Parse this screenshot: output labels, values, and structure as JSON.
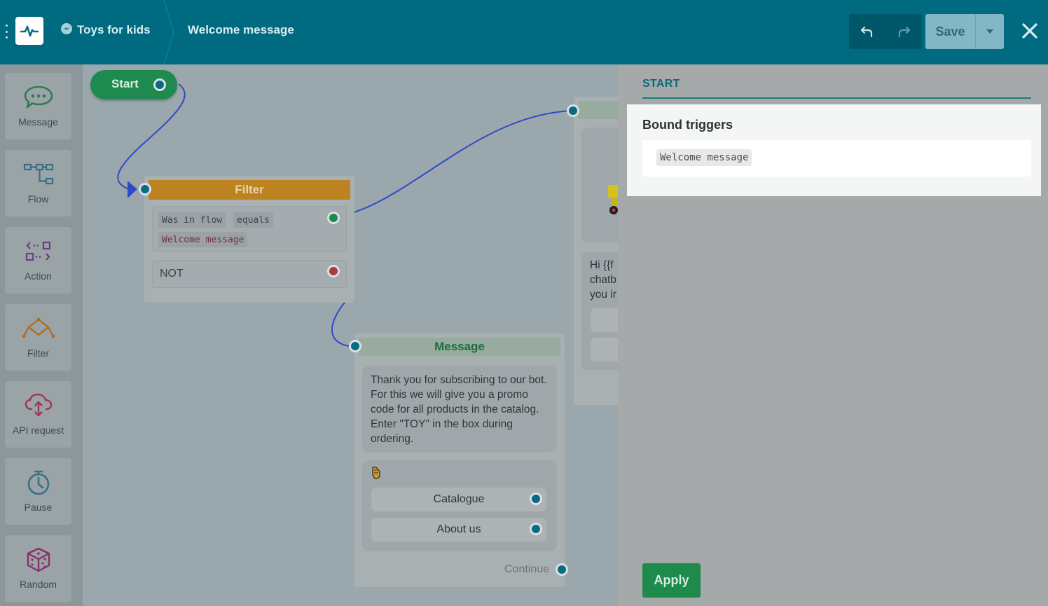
{
  "header": {
    "bot_name": "Toys for kids",
    "flow_name": "Welcome message",
    "save_label": "Save"
  },
  "toolbox": [
    {
      "label": "Message",
      "icon": "message-icon"
    },
    {
      "label": "Flow",
      "icon": "flow-icon"
    },
    {
      "label": "Action",
      "icon": "action-icon"
    },
    {
      "label": "Filter",
      "icon": "filter-icon"
    },
    {
      "label": "API request",
      "icon": "api-request-icon"
    },
    {
      "label": "Pause",
      "icon": "pause-icon"
    },
    {
      "label": "Random",
      "icon": "random-icon"
    }
  ],
  "canvas": {
    "start_label": "Start",
    "filter": {
      "title": "Filter",
      "condition": [
        "Was in flow",
        "equals",
        "Welcome message"
      ],
      "not_label": "NOT"
    },
    "message": {
      "title": "Message",
      "text": "Thank you for subscribing to our bot. For this we will give you a promo code for all products in the catalog. Enter \"TOY\" in the box during ordering.",
      "buttons": [
        "Catalogue",
        "About us"
      ],
      "continue_label": "Continue"
    },
    "partial_node": {
      "text_lines": [
        "Hi {{f",
        "chatb",
        "you ir"
      ]
    }
  },
  "panel": {
    "title": "START",
    "triggers_heading": "Bound triggers",
    "trigger": "Welcome message",
    "apply_label": "Apply"
  },
  "colors": {
    "header_bg": "#006a80",
    "start_green": "#1f8a4f",
    "filter_orange": "#bd8320",
    "apply_green": "#1e8a4c",
    "wire_blue": "#2f49c9"
  }
}
